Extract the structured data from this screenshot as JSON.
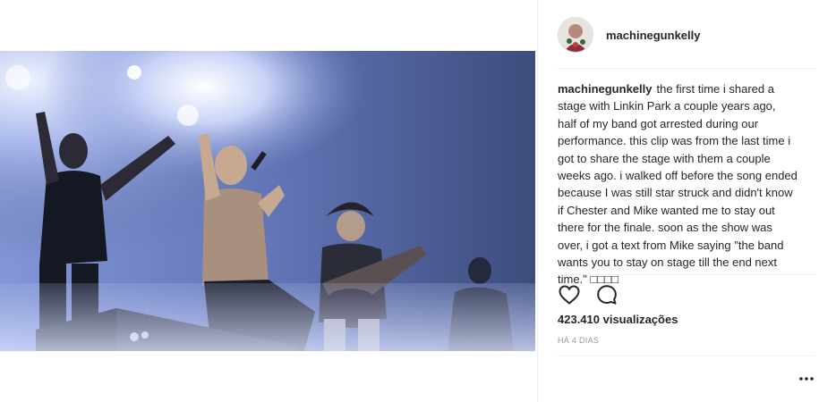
{
  "post": {
    "username": "machinegunkelly",
    "caption_user": "machinegunkelly",
    "caption_text": "the first time i shared a stage with Linkin Park a couple years ago, half of my band got arrested during our performance. this clip was from the last time i got to share the stage with them a couple weeks ago. i walked off before the song ended because I was still star struck and didn't know if Chester and Mike wanted me to stay out there for the finale. soon as the show was over, i got a text from Mike saying \"the band wants you to stay on stage till the end next time.\" □□□□",
    "views": "423.410 visualizações",
    "time_ago": "HÁ 4 DIAS"
  },
  "icons": {
    "like": "heart-icon",
    "comment": "comment-icon",
    "more": "more-options-icon"
  },
  "colors": {
    "text": "#262626",
    "muted": "#999999",
    "divider": "#efefef",
    "stage_light": "#8fa3e0"
  }
}
